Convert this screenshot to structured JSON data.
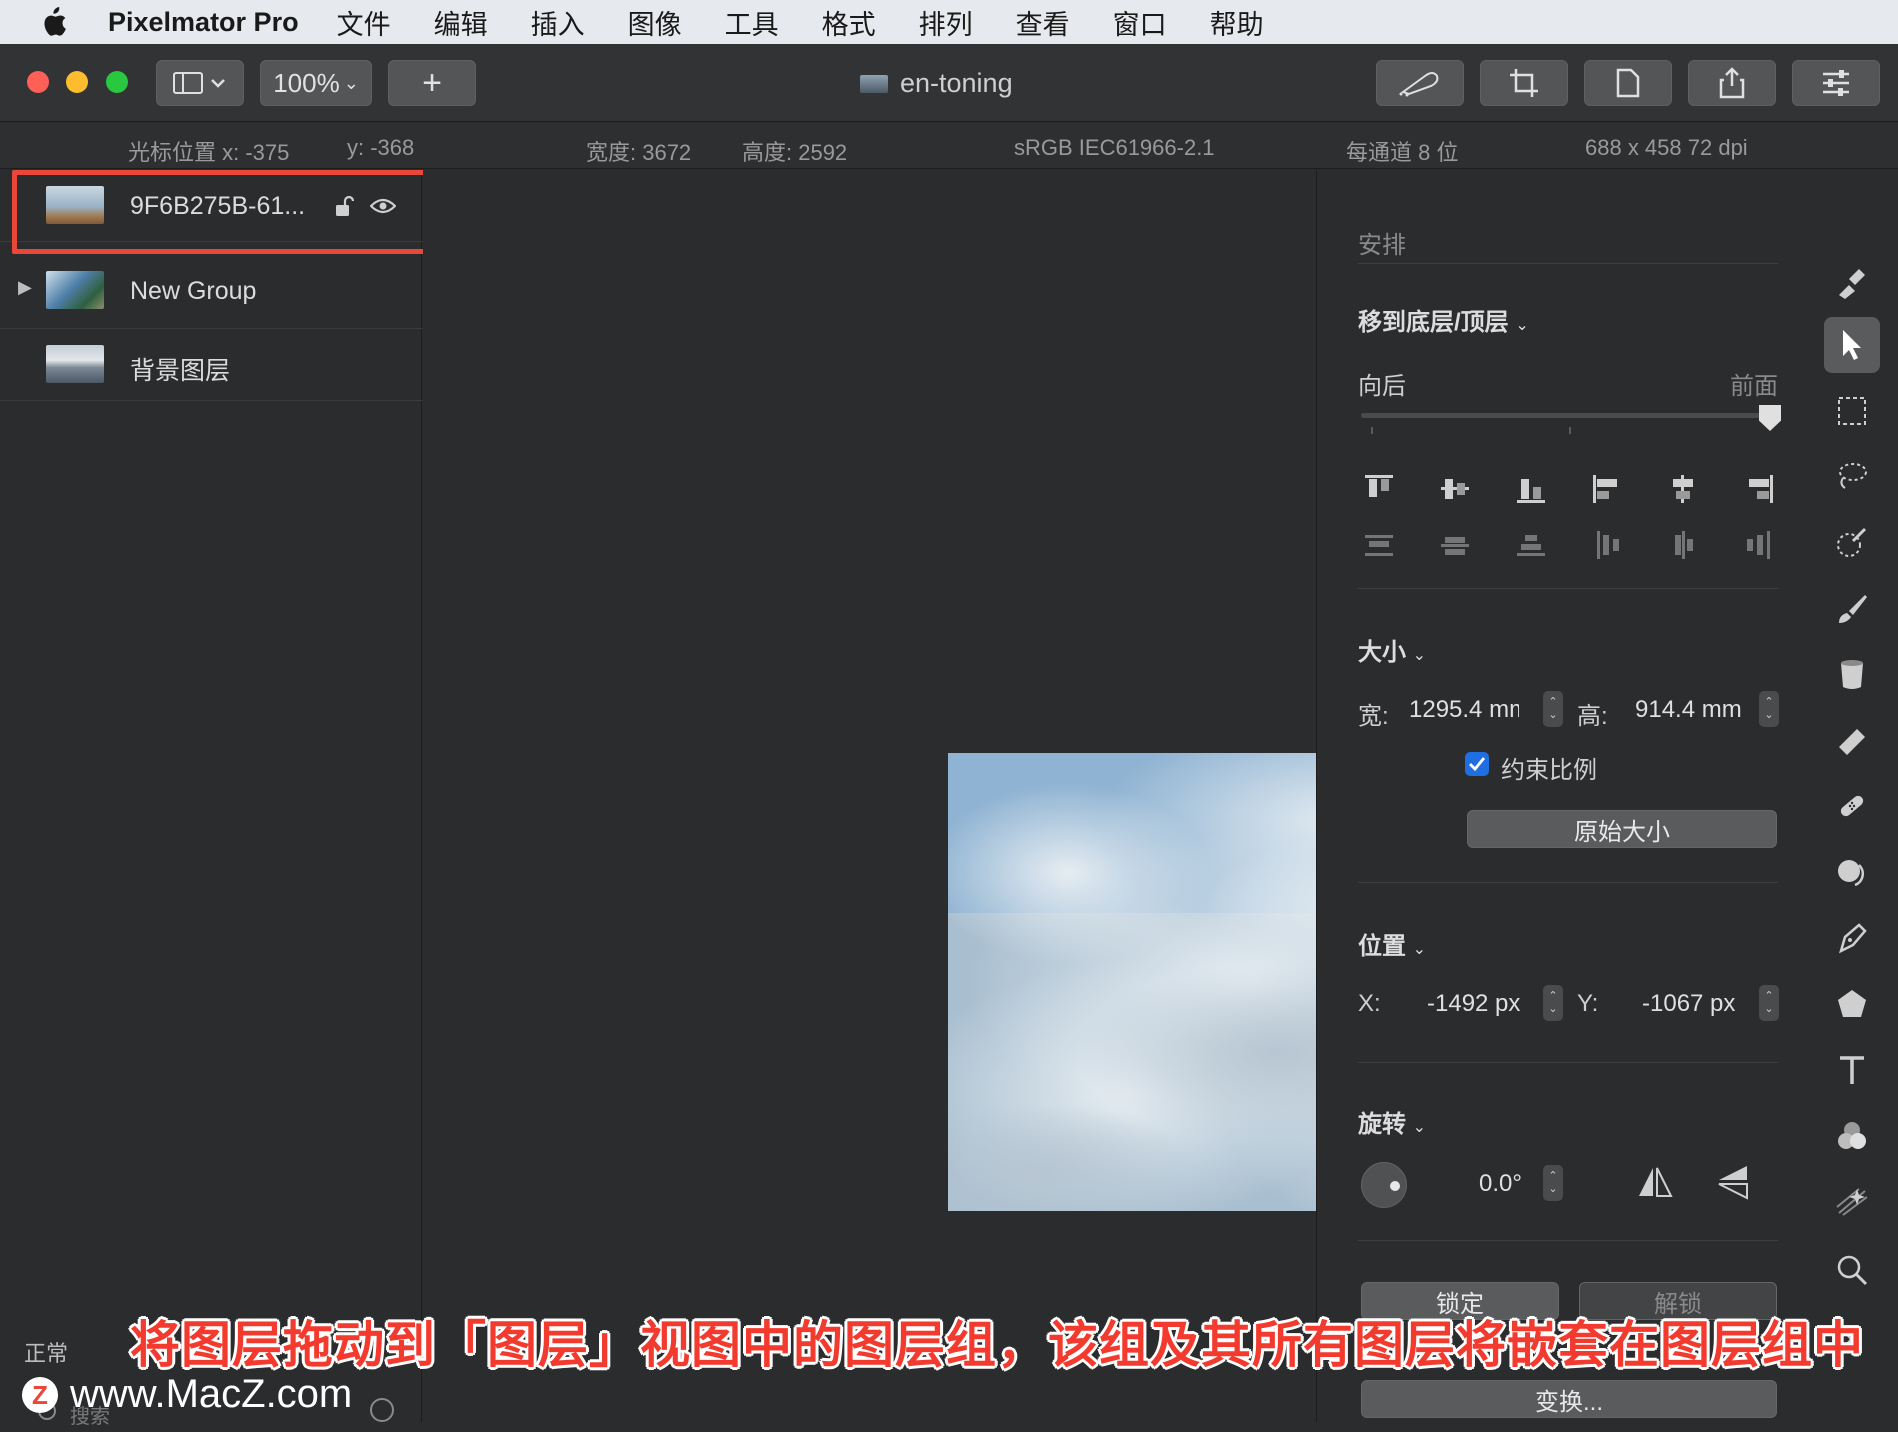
{
  "menubar": {
    "app_name": "Pixelmator Pro",
    "items": [
      "文件",
      "编辑",
      "插入",
      "图像",
      "工具",
      "格式",
      "排列",
      "查看",
      "窗口",
      "帮助"
    ]
  },
  "toolbar": {
    "zoom": "100%",
    "add_label": "+",
    "document_title": "en-toning"
  },
  "infobar": {
    "cursor_x": "光标位置 x:  -375",
    "cursor_y": "y:  -368",
    "width": "宽度:  3672",
    "height": "高度:  2592",
    "color_profile": "sRGB IEC61966-2.1",
    "bit_depth": "每通道 8 位",
    "resolution": "688 x 458 72 dpi"
  },
  "layers": {
    "items": [
      {
        "name": "9F6B275B-61...",
        "selected": true
      },
      {
        "name": "New Group",
        "group": true
      },
      {
        "name": "背景图层"
      }
    ],
    "blend_mode": "正常",
    "search_placeholder": "搜索"
  },
  "inspector": {
    "section_arrange": "安排",
    "move_label": "移到底层/顶层",
    "backward": "向后",
    "forward": "前面",
    "section_size": "大小",
    "width_label": "宽:",
    "width_value": "1295.4 mm",
    "height_label": "高:",
    "height_value": "914.4 mm",
    "constrain_label": "约束比例",
    "constrain_checked": true,
    "original_size_btn": "原始大小",
    "section_position": "位置",
    "x_label": "X:",
    "x_value": "-1492 px",
    "y_label": "Y:",
    "y_value": "-1067 px",
    "section_rotate": "旋转",
    "rotation_value": "0.0°",
    "lock_btn": "锁定",
    "unlock_btn": "解锁",
    "transform_btn": "变换..."
  },
  "caption": "将图层拖动到「图层」视图中的图层组，该组及其所有图层将嵌套在图层组中",
  "watermark": "www.MacZ.com",
  "colors": {
    "accent_blue": "#1f6fe3",
    "highlight_red": "#e8473a",
    "caption_red": "#f23b2e"
  }
}
